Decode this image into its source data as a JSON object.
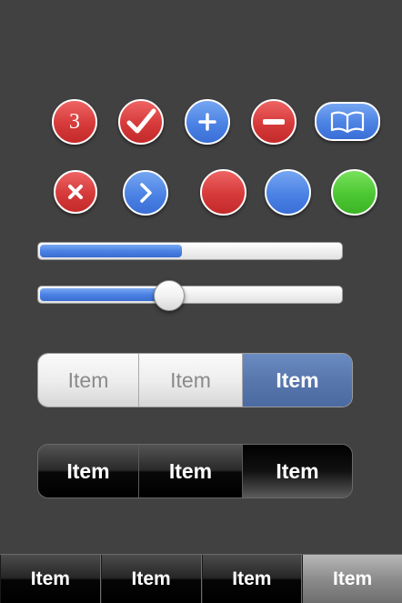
{
  "badges_row1": {
    "count_badge": {
      "value": "3",
      "color": "#d63a3a",
      "icon": "number-badge"
    },
    "check_badge": {
      "color": "#d63a3a",
      "icon": "checkmark-icon"
    },
    "add_badge": {
      "color": "#4b82e4",
      "icon": "plus-icon"
    },
    "remove_badge": {
      "color": "#d63a3a",
      "icon": "minus-icon"
    },
    "book_pill": {
      "color": "#4b82e4",
      "icon": "book-icon"
    }
  },
  "badges_row2": {
    "delete_badge": {
      "color": "#d63a3a",
      "icon": "x-icon"
    },
    "disclosure_badge": {
      "color": "#4b82e4",
      "icon": "chevron-right-icon"
    },
    "red_dot": {
      "color": "#d63a3a"
    },
    "blue_dot": {
      "color": "#4b82e4"
    },
    "green_dot": {
      "color": "#4cc833"
    }
  },
  "progress": {
    "value": 0.47
  },
  "slider": {
    "value": 0.43
  },
  "segmented_light": {
    "items": [
      "Item",
      "Item",
      "Item"
    ],
    "selected_index": 2
  },
  "segmented_dark": {
    "items": [
      "Item",
      "Item",
      "Item"
    ],
    "selected_index": 2
  },
  "tabbar": {
    "items": [
      "Item",
      "Item",
      "Item",
      "Item"
    ],
    "selected_index": 3
  }
}
